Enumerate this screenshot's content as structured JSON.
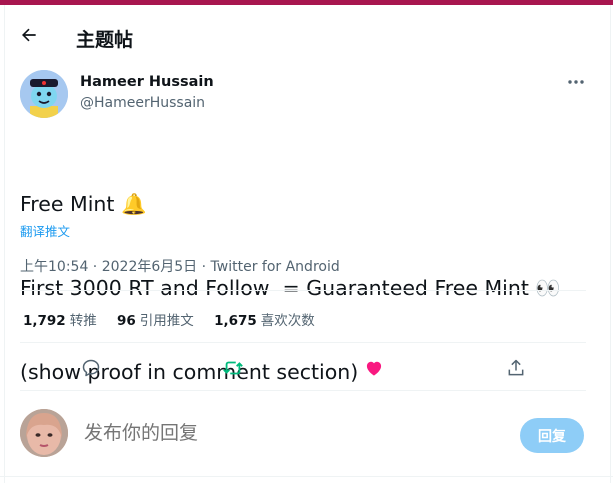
{
  "header": {
    "title": "主题帖"
  },
  "author": {
    "name": "Hameer Hussain",
    "handle": "@HameerHussain"
  },
  "tweet": {
    "lines": [
      "Free Mint 🔔",
      "First 3000 RT and Follow  = Guaranteed Free Mint 👀",
      "(show proof in comment section)"
    ],
    "translate_label": "翻译推文"
  },
  "meta": {
    "time": "上午10:54",
    "date": "2022年6月5日",
    "source": "Twitter for Android",
    "sep": " · "
  },
  "stats": {
    "retweets": {
      "count": "1,792",
      "label": "转推"
    },
    "quotes": {
      "count": "96",
      "label": "引用推文"
    },
    "likes": {
      "count": "1,675",
      "label": "喜欢次数"
    }
  },
  "reply": {
    "placeholder": "发布你的回复",
    "button_label": "回复"
  },
  "colors": {
    "accent": "#1d9bf0",
    "retweet_green": "#00ba7c",
    "like_pink": "#f91880",
    "top_bar": "#a8164f"
  },
  "icons": [
    "back-arrow-icon",
    "more-dots-icon",
    "reply-icon",
    "retweet-icon",
    "like-heart-icon",
    "share-icon"
  ]
}
